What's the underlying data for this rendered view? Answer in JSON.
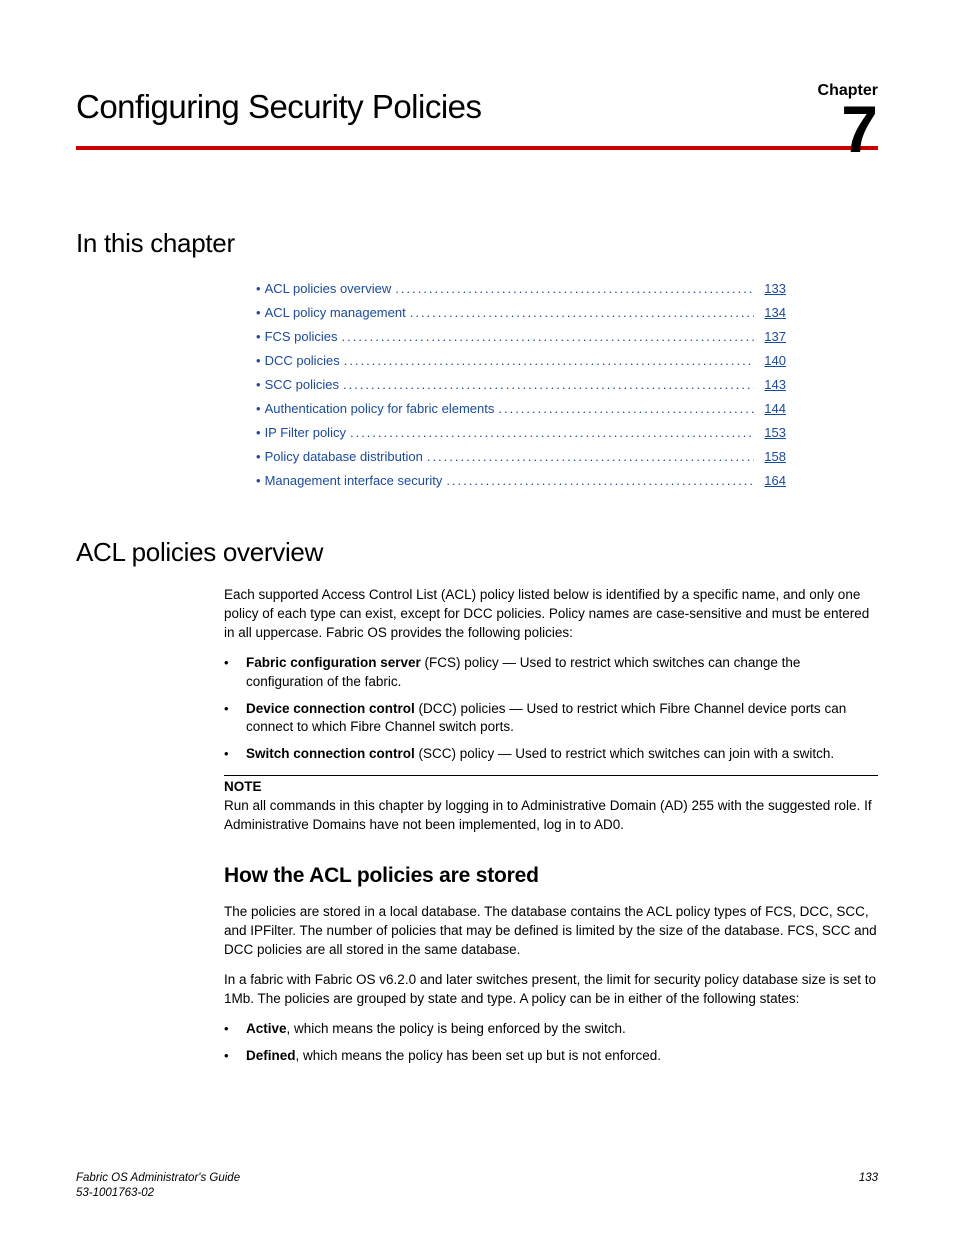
{
  "chapter": {
    "label": "Chapter",
    "number": "7",
    "title": "Configuring Security Policies"
  },
  "toc": {
    "heading": "In this chapter",
    "items": [
      {
        "label": "ACL policies overview",
        "page": "133"
      },
      {
        "label": "ACL policy management",
        "page": "134"
      },
      {
        "label": "FCS policies",
        "page": "137"
      },
      {
        "label": "DCC policies",
        "page": "140"
      },
      {
        "label": "SCC policies",
        "page": "143"
      },
      {
        "label": "Authentication policy for fabric elements",
        "page": "144"
      },
      {
        "label": "IP Filter policy",
        "page": "153"
      },
      {
        "label": "Policy database distribution",
        "page": "158"
      },
      {
        "label": "Management interface security",
        "page": "164"
      }
    ]
  },
  "section1": {
    "heading": "ACL policies overview",
    "intro": "Each supported Access Control List (ACL) policy listed below is identified by a specific name, and only one policy of each type can exist, except for DCC policies. Policy names are case-sensitive and must be entered in all uppercase. Fabric OS provides the following policies:",
    "bullets": [
      {
        "bold": "Fabric configuration server",
        "rest": " (FCS) policy — Used to restrict which switches can change the configuration of the fabric."
      },
      {
        "bold": "Device connection control",
        "rest": " (DCC) policies — Used to restrict which Fibre Channel device ports can connect to which Fibre Channel switch ports."
      },
      {
        "bold": "Switch connection control",
        "rest": " (SCC) policy — Used to restrict which switches can join with a switch."
      }
    ],
    "note_label": "NOTE",
    "note_text": "Run all commands in this chapter by logging in to Administrative Domain (AD) 255 with the suggested role. If Administrative Domains have not been implemented, log in to AD0."
  },
  "section2": {
    "heading": "How the ACL policies are stored",
    "para1": "The policies are stored in a local database. The database contains the ACL policy types of FCS, DCC, SCC, and IPFilter. The number of policies that may be defined is limited by the size of the database. FCS, SCC and DCC policies are all stored in the same database.",
    "para2": "In a fabric with Fabric OS v6.2.0 and later switches present, the limit for security policy database size is set to 1Mb. The policies are grouped by state and type. A policy can be in either of the following states:",
    "bullets": [
      {
        "bold": "Active",
        "rest": ", which means the policy is being enforced by the switch."
      },
      {
        "bold": "Defined",
        "rest": ", which means the policy has been set up but is not enforced."
      }
    ]
  },
  "footer": {
    "title": "Fabric OS Administrator's Guide",
    "docnum": "53-1001763-02",
    "page": "133"
  }
}
